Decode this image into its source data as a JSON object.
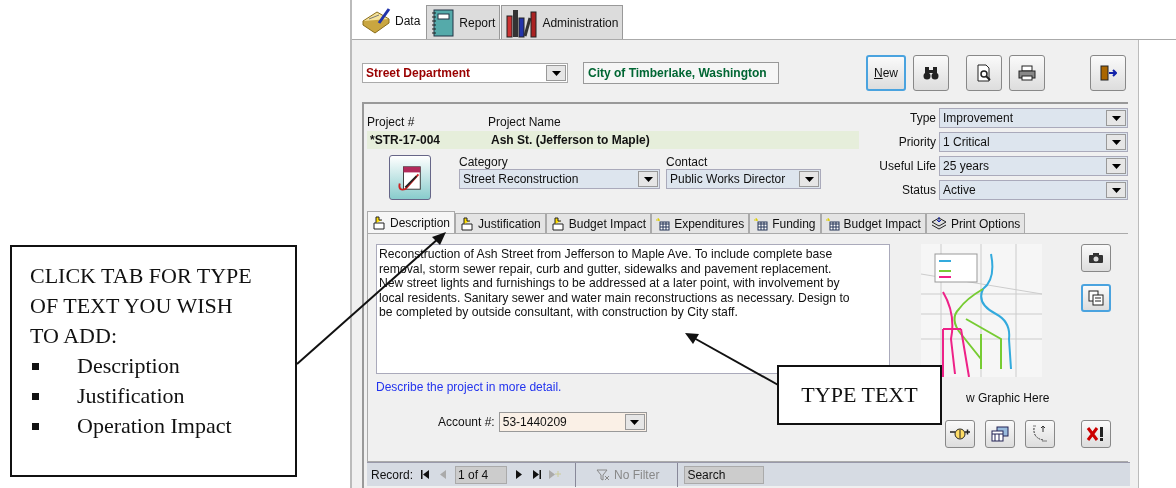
{
  "main_tabs": [
    {
      "label": "Data",
      "selected": true
    },
    {
      "label": "Report",
      "selected": false
    },
    {
      "label": "Administration",
      "selected": false
    }
  ],
  "header": {
    "department": "Street Department",
    "city": "City of Timberlake, Washington"
  },
  "toolbar": [
    {
      "kind": "new",
      "label": "New",
      "focused": true
    },
    {
      "kind": "find",
      "focused": false
    },
    {
      "kind": "preview",
      "focused": false
    },
    {
      "kind": "print",
      "focused": false
    },
    {
      "kind": "exit",
      "focused": false
    }
  ],
  "project": {
    "number_label": "Project #",
    "number": "*STR-17-004",
    "name_label": "Project Name",
    "name": "Ash St. (Jefferson to Maple)",
    "category_label": "Category",
    "category": "Street Reconstruction",
    "contact_label": "Contact",
    "contact": "Public Works Director"
  },
  "attributes": [
    {
      "label": "Type",
      "value": "Improvement"
    },
    {
      "label": "Priority",
      "value": "1 Critical"
    },
    {
      "label": "Useful Life",
      "value": "25 years"
    },
    {
      "label": "Status",
      "value": "Active"
    }
  ],
  "detail_tabs": [
    {
      "label": "Description",
      "selected": true
    },
    {
      "label": "Justification",
      "selected": false
    },
    {
      "label": "Budget Impact",
      "selected": false
    },
    {
      "label": "Expenditures",
      "selected": false
    },
    {
      "label": "Funding",
      "selected": false
    },
    {
      "label": "Budget Impact",
      "selected": false
    },
    {
      "label": "Print Options",
      "selected": false
    }
  ],
  "description": {
    "text": "Reconstruction of Ash Street from Jefferson to Maple Ave.  To include complete base removal, storm sewer repair, curb and gutter, sidewalks and pavement replacement.  New street lights and furnishings to be addressed at a later point, with involvement by local residents.  Sanitary sewer and water main reconstructions as necessary.  Design to be completed by outside consultant, with construction by City staff.",
    "hint": "Describe the project in more detail."
  },
  "account": {
    "label": "Account #:",
    "value": "53-1440209"
  },
  "graphic": {
    "caption": "w Graphic Here"
  },
  "side_buttons": [
    {
      "kind": "camera",
      "focused": false
    },
    {
      "kind": "copy",
      "focused": true
    }
  ],
  "graphic_buttons": [
    {
      "kind": "money"
    },
    {
      "kind": "forms"
    },
    {
      "kind": "swap"
    },
    {
      "kind": "delete"
    }
  ],
  "record_bar": {
    "label": "Record:",
    "position": "1 of 4",
    "nav": [
      {
        "kind": "first",
        "disabled": false
      },
      {
        "kind": "prev",
        "disabled": true
      },
      {
        "kind": "next",
        "disabled": false
      },
      {
        "kind": "last",
        "disabled": false
      },
      {
        "kind": "new",
        "disabled": true
      }
    ],
    "filter": "No Filter",
    "search": "Search"
  },
  "callouts": [
    {
      "title": "CLICK TAB FOR TYPE OF TEXT YOU WISH TO ADD:",
      "items": [
        "Description",
        "Justification",
        "Operation Impact"
      ]
    },
    {
      "title": "TYPE TEXT"
    }
  ]
}
